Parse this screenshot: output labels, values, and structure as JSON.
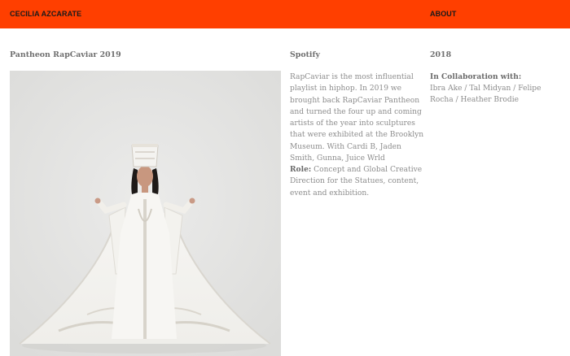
{
  "header": {
    "brand": "CECILIA AZCARATE",
    "about_label": "ABOUT"
  },
  "project": {
    "title": "Pantheon RapCaviar 2019",
    "client": "Spotify",
    "year": "2018",
    "description": "RapCaviar is the most influential playlist in hiphop. In 2019 we brought back RapCaviar Pantheon and turned the four up and coming artists of the year into sculptures that were exhibited at the Brooklyn Museum. With Cardi B, Jaden Smith, Gunna, Juice Wrld",
    "role_label": "Role:",
    "role_text": "Concept and Global Creative Direction for the Statues, content, event and exhibition.",
    "collaboration_label": "In Collaboration with:",
    "collaborators": "Ibra Ake / Tal Midyan / Felipe Rocha / Heather Brodie"
  },
  "colors": {
    "accent": "#ff3f00",
    "header_text": "#1a1a1a",
    "body_text": "#8c8c8c",
    "photo_background": "#e3e3e1"
  }
}
